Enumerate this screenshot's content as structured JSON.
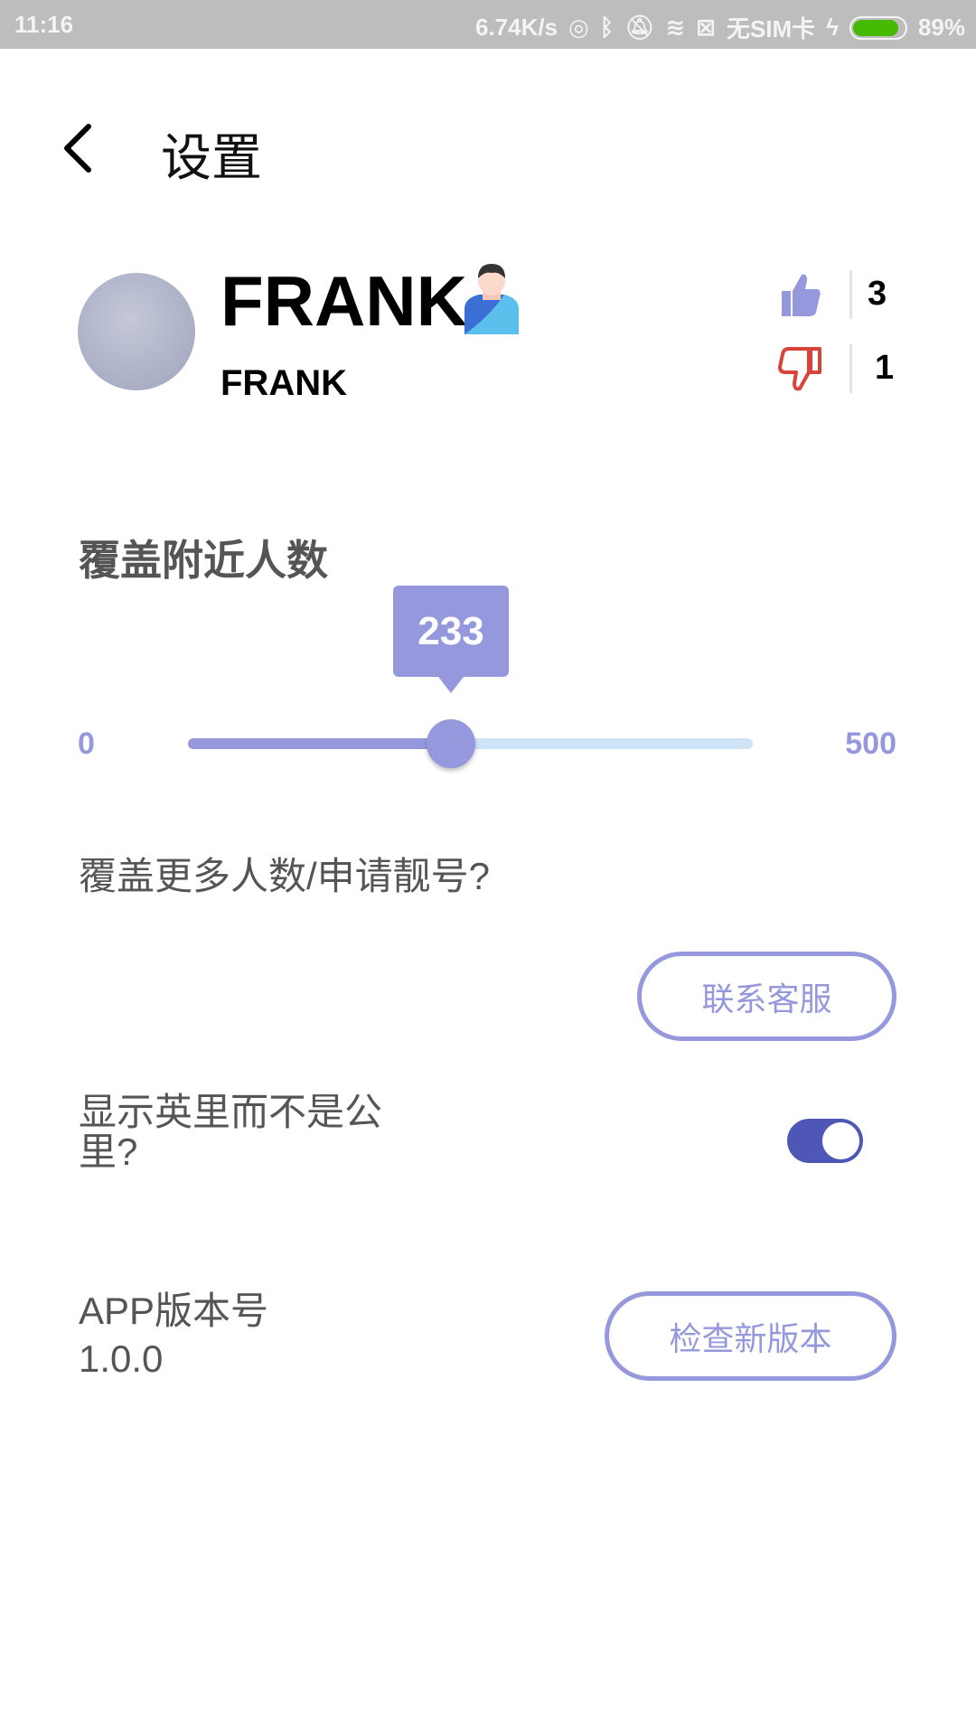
{
  "status_bar": {
    "time": "11:16",
    "net_speed": "6.74K/s",
    "sim": "无SIM卡",
    "battery": "89%",
    "battery_level": 0.89,
    "icons": [
      "hotspot-icon",
      "bluetooth-icon",
      "mute-icon",
      "wifi-icon",
      "sim-x-icon",
      "charging-icon",
      "battery-icon"
    ]
  },
  "header": {
    "title": "设置",
    "back_icon": "chevron-left-icon"
  },
  "profile": {
    "name": "FRANK",
    "username": "FRANK",
    "badge_icon": "male-user-icon",
    "likes": "3",
    "dislikes": "1",
    "like_color": "#9598dc",
    "dislike_color": "#d9433a"
  },
  "coverage": {
    "heading": "覆盖附近人数",
    "value": "233",
    "min": "0",
    "max": "500",
    "fraction": 0.466,
    "accent": "#9598dc"
  },
  "more": {
    "question": "覆盖更多人数/申请靓号?",
    "button": "联系客服"
  },
  "miles": {
    "label": "显示英里而不是公里?",
    "enabled": true
  },
  "version": {
    "label": "APP版本号",
    "value": "1.0.0",
    "button": "检查新版本"
  }
}
